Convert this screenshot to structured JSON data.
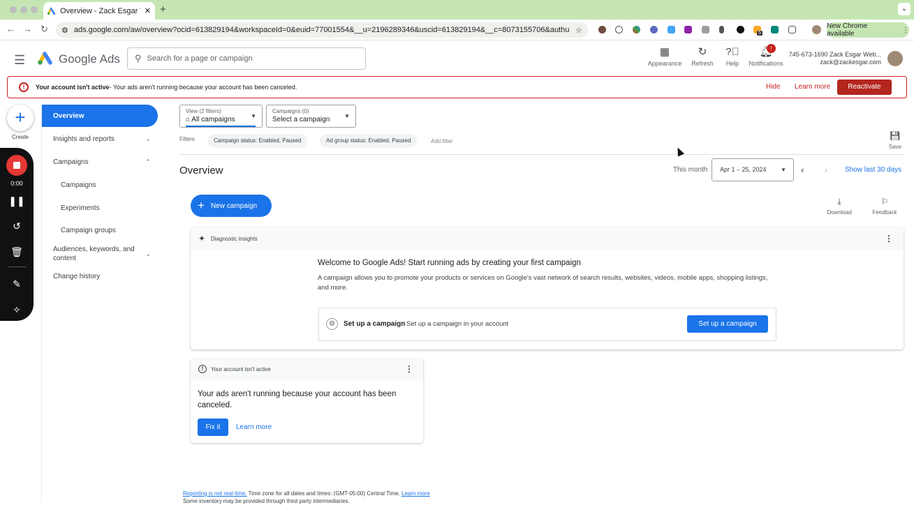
{
  "browser": {
    "tab_title": "Overview - Zack Esgar Webs",
    "url": "ads.google.com/aw/overview?ocid=613829194&workspaceId=0&euid=77001554&__u=2196289346&uscid=613829194&__c=8073155706&authuser=0&su...",
    "update_label": "New Chrome available",
    "ext_badge": "5"
  },
  "header": {
    "brand": "Google Ads",
    "search_placeholder": "Search for a page or campaign",
    "appearance": "Appearance",
    "refresh": "Refresh",
    "help": "Help",
    "notifications": "Notifications",
    "notif_badge": "!",
    "account_line1": "745-673-1690 Zack Esgar Web...",
    "account_line2": "zack@zackesgar.com"
  },
  "banner": {
    "bold": "Your account isn't active",
    "text": " - Your ads aren't running because your account has been canceled.",
    "hide": "Hide",
    "learn_more": "Learn more",
    "reactivate": "Reactivate"
  },
  "rail": {
    "create": "Create",
    "timer": "0:00"
  },
  "sidebar": {
    "overview": "Overview",
    "insights": "Insights and reports",
    "campaigns_group": "Campaigns",
    "campaigns": "Campaigns",
    "experiments": "Experiments",
    "campaign_groups": "Campaign groups",
    "audiences": "Audiences, keywords, and content",
    "change_history": "Change history"
  },
  "controls": {
    "view_label": "View (2 filters)",
    "view_value": "All campaigns",
    "campaigns_label": "Campaigns (0)",
    "campaigns_value": "Select a campaign",
    "filters": "Filters",
    "chip1": "Campaign status: Enabled, Paused",
    "chip2": "Ad group status: Enabled, Paused",
    "add_filter": "Add filter",
    "save": "Save"
  },
  "overview": {
    "title": "Overview",
    "this_month": "This month",
    "date_range": "Apr 1 – 25, 2024",
    "show_last": "Show last 30 days",
    "new_campaign": "New campaign",
    "download": "Download",
    "feedback": "Feedback"
  },
  "insights_card": {
    "header": "Diagnostic insights",
    "title": "Welcome to Google Ads! Start running ads by creating your first campaign",
    "description": "A campaign allows you to promote your products or services on Google's vast network of search results, websites, videos, mobile apps, shopping listings, and more.",
    "setup_title": "Set up a campaign",
    "setup_sub": "Set up a campaign in your account",
    "setup_button": "Set up a campaign"
  },
  "status_card": {
    "header": "Your account isn't active",
    "message": "Your ads aren't running because your account has been canceled.",
    "fix": "Fix it",
    "learn_more": "Learn more"
  },
  "footer": {
    "link1": "Reporting is not real-time.",
    "text1": " Time zone for all dates and times: (GMT-05:00) Central Time. ",
    "link2": "Learn more",
    "line2": "Some inventory may be provided through third party intermediaries."
  }
}
